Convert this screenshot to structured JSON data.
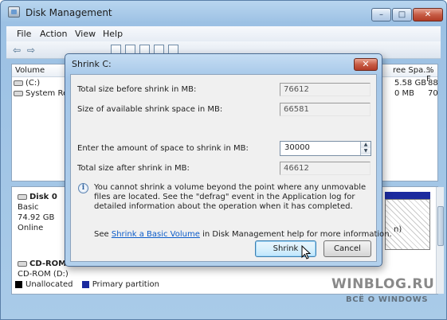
{
  "window": {
    "title": "Disk Management",
    "controls": {
      "minimize": "–",
      "maximize": "□",
      "close": "✕"
    }
  },
  "menu": [
    "File",
    "Action",
    "View",
    "Help"
  ],
  "toolbar": {
    "back_icon": "⇦",
    "forward_icon": "⇨"
  },
  "volume_list": {
    "columns": {
      "volume": "Volume",
      "free_space": "ree Spa...",
      "percent_free": "% F"
    },
    "rows": [
      {
        "volume": "(C:)",
        "free_space": "5.58 GB",
        "percent_free": "88"
      },
      {
        "volume": "System Res",
        "free_space": "0 MB",
        "percent_free": "70"
      }
    ]
  },
  "disk_map": {
    "disk0": {
      "name": "Disk 0",
      "type": "Basic",
      "size": "74.92 GB",
      "status": "Online"
    },
    "partial_text": "n)",
    "cdrom": {
      "name": "CD-ROM",
      "drive": "CD-ROM (D:)"
    },
    "legend": {
      "unallocated": "Unallocated",
      "primary": "Primary partition",
      "unallocated_color": "#000000",
      "primary_color": "#1b2a9e"
    }
  },
  "dialog": {
    "title": "Shrink C:",
    "close_label": "✕",
    "total_before_label": "Total size before shrink in MB:",
    "total_before_value": "76612",
    "available_label": "Size of available shrink space in MB:",
    "available_value": "66581",
    "amount_label": "Enter the amount of space to shrink in MB:",
    "amount_value": "30000",
    "total_after_label": "Total size after shrink in MB:",
    "total_after_value": "46612",
    "info_icon": "i",
    "info_text": "You cannot shrink a volume beyond the point where any unmovable files are located. See the \"defrag\" event in the Application log for detailed information about the operation when it has completed.",
    "help_prefix": "See ",
    "help_link": "Shrink a Basic Volume",
    "help_suffix": " in Disk Management help for more information.",
    "shrink_button": "Shrink",
    "cancel_button": "Cancel"
  },
  "watermark": {
    "line1": "WINBLOG.RU",
    "line2": "ВСЁ О WINDOWS"
  }
}
